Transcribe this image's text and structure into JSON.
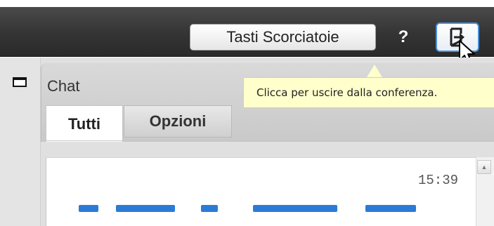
{
  "toolbar": {
    "shortcuts_label": "Tasti Scorciatoie",
    "help_label": "?",
    "exit_icon": "exit-icon",
    "exit_tooltip": "Clicca per uscire dalla conferenza."
  },
  "panel": {
    "title": "Chat",
    "tabs": [
      {
        "label": "Tutti",
        "selected": true
      },
      {
        "label": "Opzioni",
        "selected": false
      }
    ]
  },
  "chat": {
    "timestamp": "15:39"
  },
  "colors": {
    "toolbar_bg": "#343434",
    "tooltip_bg": "#ffffcc",
    "exit_button_border": "#4a90d9",
    "message_link": "#2b7bd6"
  }
}
